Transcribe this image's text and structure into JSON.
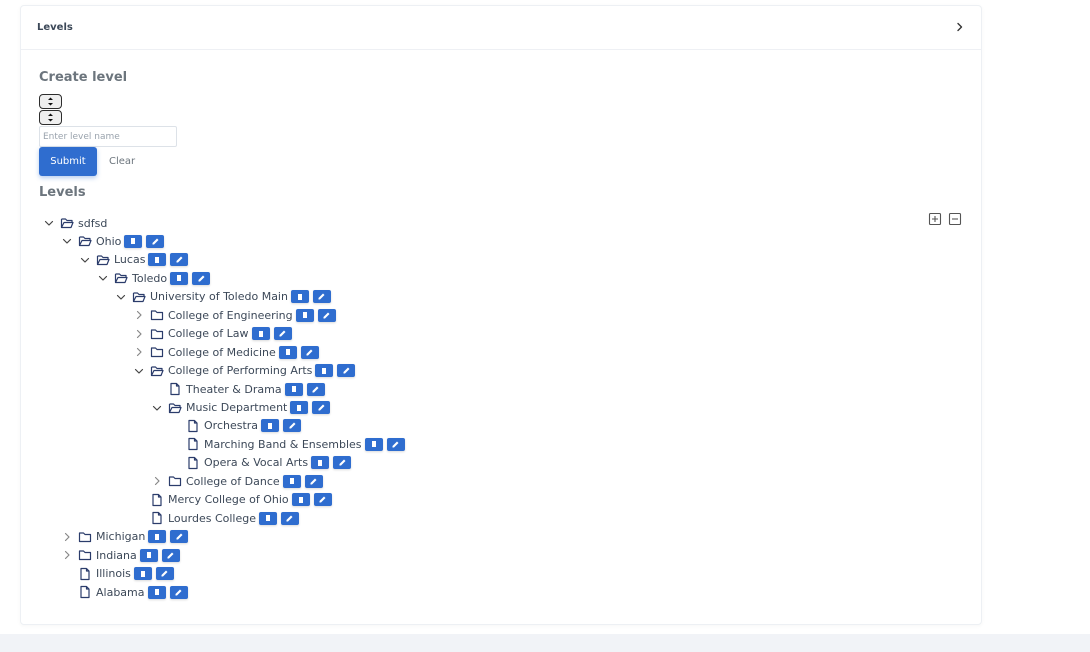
{
  "card": {
    "title": "Levels"
  },
  "create": {
    "title": "Create level",
    "input_placeholder": "Enter level name",
    "submit_label": "Submit",
    "clear_label": "Clear"
  },
  "levels_title": "Levels",
  "tree": [
    {
      "label": "sdfsd",
      "kind": "folder",
      "state": "open",
      "actions": false
    },
    {
      "label": "Ohio",
      "kind": "folder",
      "state": "open",
      "actions": true
    },
    {
      "label": "Lucas",
      "kind": "folder",
      "state": "open",
      "actions": true
    },
    {
      "label": "Toledo",
      "kind": "folder",
      "state": "open",
      "actions": true
    },
    {
      "label": "University of Toledo Main",
      "kind": "folder",
      "state": "open",
      "actions": true
    },
    {
      "label": "College of Engineering",
      "kind": "folder",
      "state": "closed",
      "actions": true
    },
    {
      "label": "College of Law",
      "kind": "folder",
      "state": "closed",
      "actions": true
    },
    {
      "label": "College of Medicine",
      "kind": "folder",
      "state": "closed",
      "actions": true
    },
    {
      "label": "College of Performing Arts",
      "kind": "folder",
      "state": "open",
      "actions": true
    },
    {
      "label": "Theater & Drama",
      "kind": "file",
      "state": "none",
      "actions": true
    },
    {
      "label": "Music Department",
      "kind": "folder",
      "state": "open",
      "actions": true
    },
    {
      "label": "Orchestra",
      "kind": "file",
      "state": "none",
      "actions": true
    },
    {
      "label": "Marching Band & Ensembles",
      "kind": "file",
      "state": "none",
      "actions": true
    },
    {
      "label": "Opera & Vocal Arts",
      "kind": "file",
      "state": "none",
      "actions": true
    },
    {
      "label": "College of Dance",
      "kind": "folder",
      "state": "closed",
      "actions": true
    },
    {
      "label": "Mercy College of Ohio",
      "kind": "file",
      "state": "none",
      "actions": true
    },
    {
      "label": "Lourdes College",
      "kind": "file",
      "state": "none",
      "actions": true
    },
    {
      "label": "Michigan",
      "kind": "folder",
      "state": "closed",
      "actions": true
    },
    {
      "label": "Indiana",
      "kind": "folder",
      "state": "closed",
      "actions": true
    },
    {
      "label": "Illinois",
      "kind": "file",
      "state": "none",
      "actions": true
    },
    {
      "label": "Alabama",
      "kind": "file",
      "state": "none",
      "actions": true
    }
  ],
  "icons": {
    "expand_all": "plus-square-icon",
    "collapse_all": "minus-square-icon",
    "delete": "trash-icon",
    "edit": "pencil-icon"
  },
  "colors": {
    "accent": "#2f6dcf",
    "text": "#3c4858",
    "muted": "#6c757d"
  }
}
